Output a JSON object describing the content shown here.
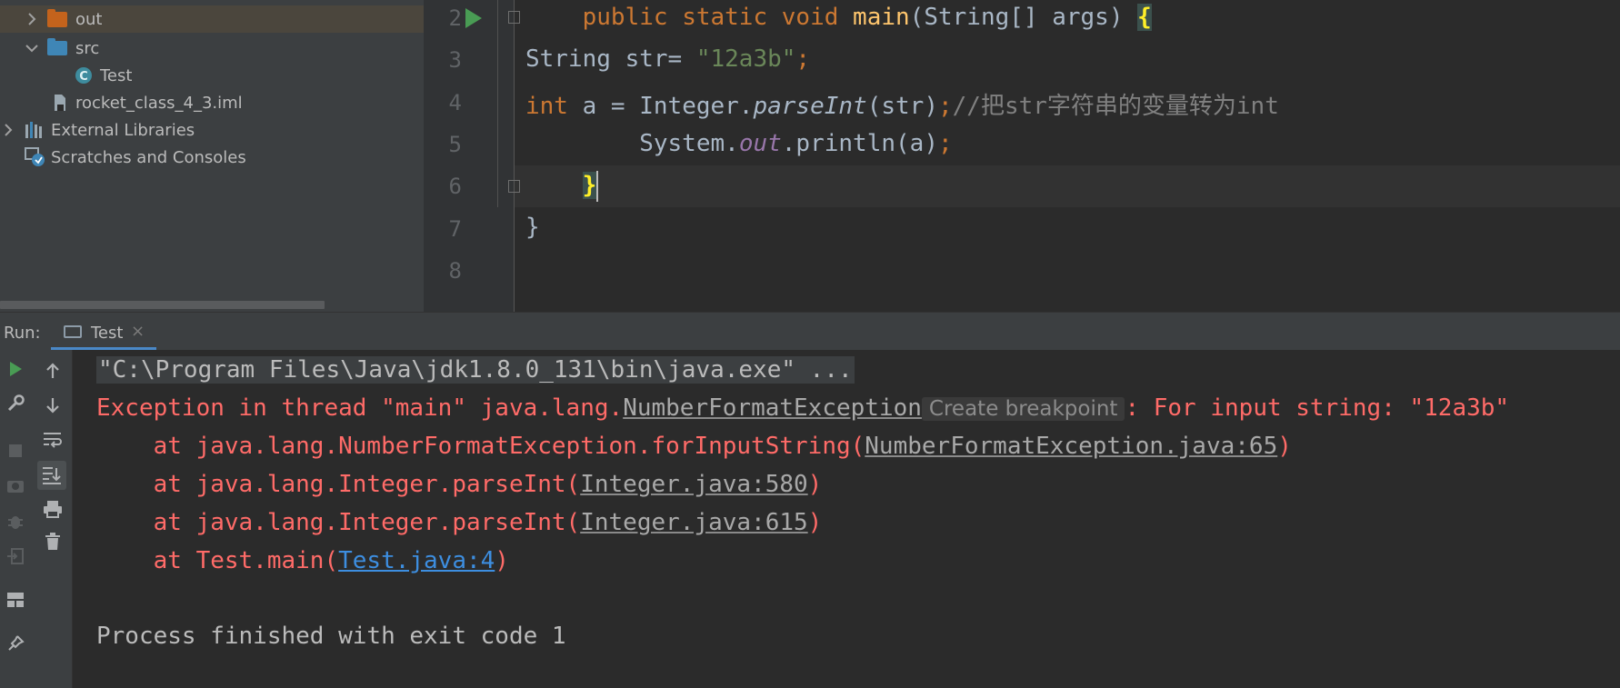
{
  "project_tree": {
    "items": [
      {
        "label": "out",
        "type": "folder",
        "expanded": false,
        "color": "#c4631c"
      },
      {
        "label": "src",
        "type": "folder",
        "expanded": true,
        "color": "#3f86b6"
      },
      {
        "label": "Test",
        "type": "java-class"
      },
      {
        "label": "rocket_class_4_3.iml",
        "type": "iml-file"
      },
      {
        "label": "External Libraries",
        "type": "libraries",
        "expanded": false
      },
      {
        "label": "Scratches and Consoles",
        "type": "scratches"
      }
    ]
  },
  "editor": {
    "line_numbers": [
      "2",
      "3",
      "4",
      "5",
      "6",
      "7",
      "8"
    ],
    "lines": {
      "l2": {
        "indent": "    ",
        "kw1": "public static void ",
        "fn": "main",
        "rest": "(String[] args) ",
        "brace": "{"
      },
      "l3": {
        "t1": "String str= ",
        "str": "\"12a3b\"",
        "semi": ";"
      },
      "l4": {
        "kw": "int",
        "t1": " a = Integer.",
        "method": "parseInt",
        "t2": "(str)",
        "semi": ";",
        "comment": "//把str字符串的变量转为int"
      },
      "l5": {
        "t1": "        System.",
        "field": "out",
        "t2": ".println(a)",
        "semi": ";"
      },
      "l6": {
        "indent": "    ",
        "brace": "}"
      },
      "l7": {
        "brace": "}"
      }
    }
  },
  "run_panel": {
    "label": "Run:",
    "tab_label": "Test",
    "tab_close": "×",
    "console": {
      "command": "\"C:\\Program Files\\Java\\jdk1.8.0_131\\bin\\java.exe\" ...",
      "exception_prefix": "Exception in thread \"main\" java.lang.",
      "exception_class": "NumberFormatException",
      "breakpoint_hint": "Create breakpoint",
      "exception_suffix": ": For input string: \"12a3b\"",
      "stack": [
        {
          "prefix": "    at java.lang.NumberFormatException.forInputString(",
          "link": "NumberFormatException.java:65",
          "suffix": ")"
        },
        {
          "prefix": "    at java.lang.Integer.parseInt(",
          "link": "Integer.java:580",
          "suffix": ")"
        },
        {
          "prefix": "    at java.lang.Integer.parseInt(",
          "link": "Integer.java:615",
          "suffix": ")"
        },
        {
          "prefix": "    at Test.main(",
          "link": "Test.java:4",
          "suffix": ")"
        }
      ],
      "finish": "Process finished with exit code 1"
    }
  },
  "colors": {
    "keyword": "#cc7832",
    "function": "#ffc66d",
    "string": "#6a8759",
    "comment": "#808080",
    "error": "#ff6b68",
    "link": "#3d8ee0"
  }
}
